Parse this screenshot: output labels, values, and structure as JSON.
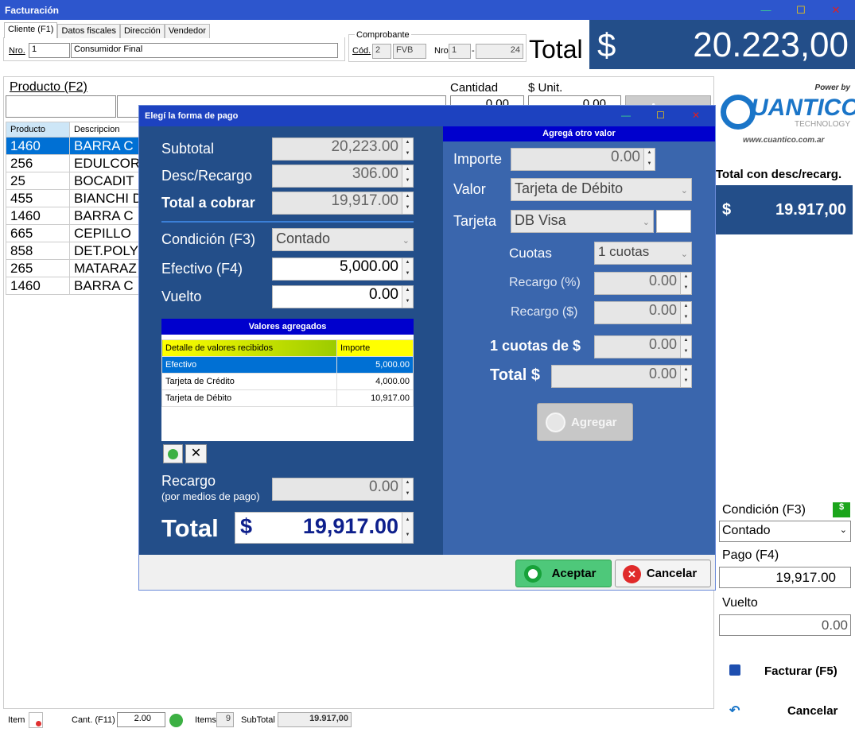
{
  "window": {
    "title": "Facturación",
    "min": "—",
    "max": "☐",
    "close": "✕"
  },
  "client": {
    "tabs": [
      "Cliente (F1)",
      "Datos fiscales",
      "Dirección",
      "Vendedor"
    ],
    "nro_label": "Nro.",
    "nro_value": "1",
    "name": "Consumidor Final"
  },
  "comprobante": {
    "legend": "Comprobante",
    "cod_label": "Cód.",
    "cod_value": "2",
    "tipo": "FVB",
    "nro_label": "Nro",
    "pv": "1",
    "sep": "-",
    "numero": "24"
  },
  "total": {
    "label": "Total",
    "currency": "$",
    "value": "20.223,00"
  },
  "product": {
    "label": "Producto (F2)",
    "qty_label": "Cantidad",
    "unit_label": "$ Unit.",
    "qty_value": "0.00",
    "unit_value": "0.00",
    "add_label": "Agregar"
  },
  "grid": {
    "headers": [
      "Producto",
      "Descripcion"
    ],
    "rows": [
      [
        "1460",
        "BARRA C"
      ],
      [
        "256",
        "EDULCOR"
      ],
      [
        "25",
        "BOCADIT"
      ],
      [
        "455",
        "BIANCHI D"
      ],
      [
        "1460",
        "BARRA C"
      ],
      [
        "665",
        "CEPILLO"
      ],
      [
        "858",
        "DET.POLY"
      ],
      [
        "265",
        "MATARAZ"
      ],
      [
        "1460",
        "BARRA C"
      ]
    ]
  },
  "brand": {
    "power": "Power by",
    "name": "UANTICO",
    "sub": "TECHNOLOGY",
    "url": "www.cuantico.com.ar"
  },
  "side": {
    "total_label": "Total con desc/recarg.",
    "currency": "$",
    "total_value": "19.917,00",
    "cond_label": "Condición (F3)",
    "cond_value": "Contado",
    "pago_label": "Pago (F4)",
    "pago_value": "19,917.00",
    "vuelto_label": "Vuelto",
    "vuelto_value": "0.00",
    "facturar": "Facturar (F5)",
    "cancelar": "Cancelar"
  },
  "footer": {
    "item_label": "Item",
    "cant_label": "Cant. (F11)",
    "cant_value": "2.00",
    "items_label": "Items",
    "items_value": "9",
    "subtotal_label": "SubTotal",
    "subtotal_value": "19.917,00"
  },
  "dialog": {
    "title": "Elegí la forma de pago",
    "subtotal_label": "Subtotal",
    "subtotal": "20,223.00",
    "desc_label": "Desc/Recargo",
    "desc": "306.00",
    "cobrar_label": "Total a cobrar",
    "cobrar": "19,917.00",
    "cond_label": "Condición (F3)",
    "cond": "Contado",
    "efectivo_label": "Efectivo (F4)",
    "efectivo": "5,000.00",
    "vuelto_label": "Vuelto",
    "vuelto": "0.00",
    "valores_title": "Valores agregados",
    "valores_headers": [
      "Detalle de valores recibidos",
      "Importe"
    ],
    "valores": [
      [
        "Efectivo",
        "5,000.00"
      ],
      [
        "Tarjeta de Crédito",
        "4,000.00"
      ],
      [
        "Tarjeta de Débito",
        "10,917.00"
      ]
    ],
    "recargo_label": "Recargo",
    "recargo_sub": "(por medios de pago)",
    "recargo": "0.00",
    "total_label": "Total",
    "total_currency": "$",
    "total": "19,917.00",
    "otro_title": "Agregá otro valor",
    "importe_label": "Importe",
    "importe": "0.00",
    "valor_label": "Valor",
    "valor": "Tarjeta de Débito",
    "tarjeta_label": "Tarjeta",
    "tarjeta": "DB Visa",
    "cuotas_label": "Cuotas",
    "cuotas": "1 cuotas",
    "recpct_label": "Recargo (%)",
    "recpct": "0.00",
    "recabs_label": "Recargo ($)",
    "recabs": "0.00",
    "cuotade_label": "1 cuotas de $",
    "cuotade": "0.00",
    "totalr_label": "Total $",
    "totalr": "0.00",
    "agregar": "Agregar",
    "aceptar": "Aceptar",
    "cancelar": "Cancelar"
  }
}
